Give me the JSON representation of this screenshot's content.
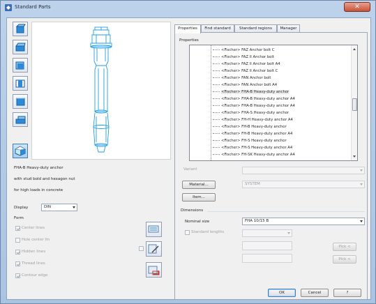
{
  "window": {
    "title": "Standard Parts",
    "close_glyph": "✕"
  },
  "left": {
    "description": [
      "FHA-B Heavy-duty anchor",
      "with stud bold and hexagon nut",
      "for high loads in concrete"
    ],
    "display_label": "Display",
    "display_value": "DIN",
    "form_label": "Form",
    "form_options": [
      {
        "label": "Center lines",
        "checked": true
      },
      {
        "label": "Hole center lin",
        "checked": false
      },
      {
        "label": "Hidden lines",
        "checked": true
      },
      {
        "label": "Thread lines",
        "checked": true
      },
      {
        "label": "Contour edge",
        "checked": true
      }
    ]
  },
  "tabs": [
    {
      "label": "Properties",
      "active": true
    },
    {
      "label": "Find standard",
      "active": false
    },
    {
      "label": "Standard regions",
      "active": false
    },
    {
      "label": "Manager",
      "active": false
    }
  ],
  "properties": {
    "heading": "Properties",
    "items": [
      "<Fischer> FAZ Anchor bolt C",
      "<Fischer> FAZ II Anchor bolt",
      "<Fischer> FAZ II Anchor bolt A4",
      "<Fischer> FAZ II Anchor bolt C",
      "<Fischer> FAN Anchor bolt",
      "<Fischer> FAN Anchor bolt A4",
      "<Fischer> FHA-B Heavy-duty anchor",
      "<Fischer> FHA-B Heavy-duty anchor A4",
      "<Fischer> FHA-B Heavy-duty anchor A4",
      "<Fischer> FHA-S Heavy-duty anchor",
      "<Fischer> FH-H Heavy-duty anchor A4",
      "<Fischer> FH-B Heavy-duty anchor",
      "<Fischer> FH-B Heavy-duty anchor A4",
      "<Fischer> FH-S Heavy-duty anchor",
      "<Fischer> FH-S Heavy-duty anchor A4",
      "<Fischer> FH-SK Heavy-duty anchor A4"
    ],
    "selected_index": 6,
    "variant_label": "Variant",
    "material_button": "Material...",
    "material_value": "SYSTEM",
    "item_button": "Item..."
  },
  "dimensions": {
    "heading": "Dimensions",
    "nominal_size_label": "Nominal size",
    "nominal_size_value": "FHA 10/15 B",
    "standard_lengths_label": "Standard lengths",
    "pick_label_1": "Pick <",
    "pick_label_2": "Pick <"
  },
  "footer": {
    "ok": "OK",
    "cancel": "Cancel",
    "help": "?"
  },
  "colors": {
    "drawing_cyan": "#1e9ee8",
    "selection_blue": "#3c7fc1"
  }
}
